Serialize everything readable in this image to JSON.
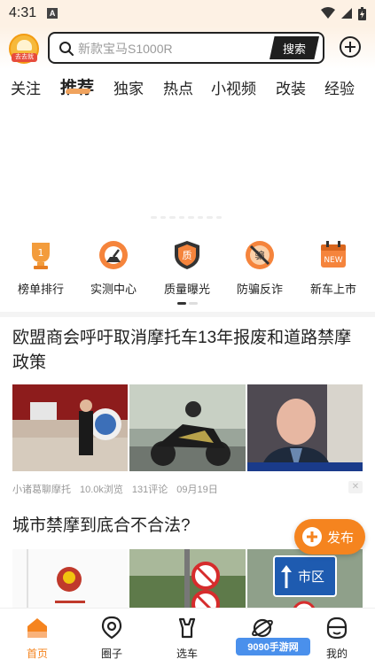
{
  "status_bar": {
    "time": "4:31",
    "notification_letter": "A"
  },
  "header": {
    "logo_label": "去去就",
    "search_placeholder": "新款宝马S1000R",
    "search_button": "搜索"
  },
  "tabs": [
    "关注",
    "推荐",
    "独家",
    "热点",
    "小视频",
    "改装",
    "经验"
  ],
  "active_tab": "推荐",
  "quick_links": [
    {
      "label": "榜单排行",
      "icon": "trophy-icon"
    },
    {
      "label": "实测中心",
      "icon": "speedometer-icon"
    },
    {
      "label": "质量曝光",
      "icon": "quality-shield-icon"
    },
    {
      "label": "防骗反诈",
      "icon": "no-fraud-icon"
    },
    {
      "label": "新车上市",
      "icon": "new-calendar-icon"
    }
  ],
  "articles": [
    {
      "title": "欧盟商会呼吁取消摩托车13年报废和道路禁摩政策",
      "source": "小诸葛聊摩托",
      "views": "10.0k浏览",
      "comments": "131评论",
      "date": "09月19日"
    },
    {
      "title": "城市禁摩到底合不合法?",
      "sign_text": "市区"
    }
  ],
  "publish_button": "发布",
  "bottom_nav": [
    {
      "label": "首页",
      "icon": "home-icon"
    },
    {
      "label": "圈子",
      "icon": "location-pin-icon"
    },
    {
      "label": "选车",
      "icon": "motorcycle-icon"
    },
    {
      "label": "",
      "icon": "planet-icon"
    },
    {
      "label": "我的",
      "icon": "profile-icon"
    }
  ],
  "watermark_text": "9090手游网",
  "colors": {
    "accent": "#f5841f",
    "header_bg": "#fdf1e4"
  }
}
